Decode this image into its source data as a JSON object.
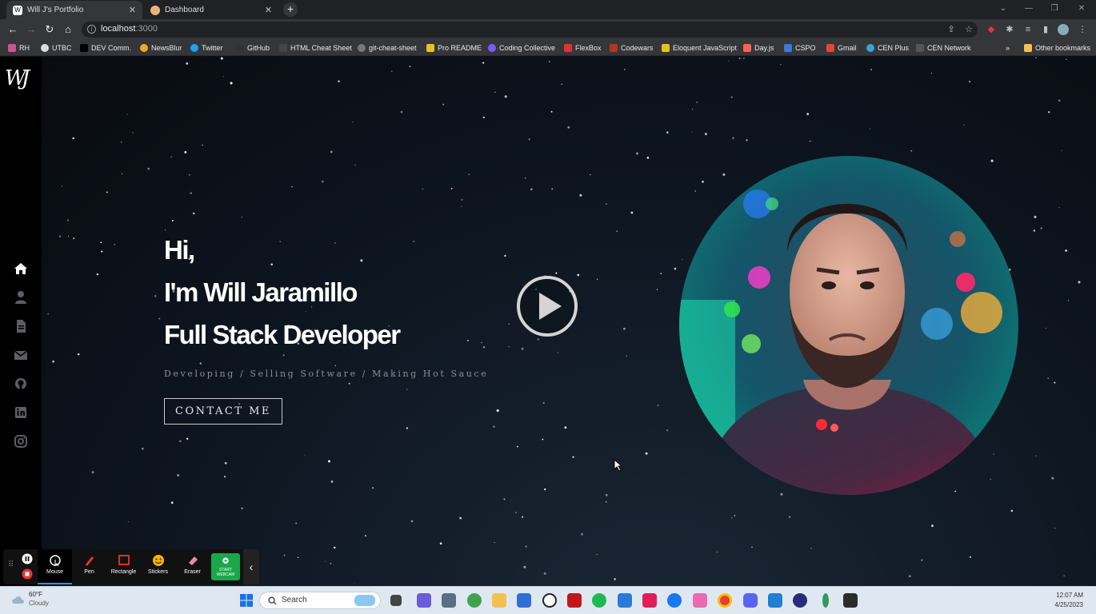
{
  "browser": {
    "tabs": [
      {
        "title": "Will J's Portfolio",
        "active": true
      },
      {
        "title": "Dashboard",
        "active": false
      }
    ],
    "url_host": "localhost",
    "url_port": ":3000",
    "bookmarks": [
      "RH",
      "UTBC",
      "DEV Comm.",
      "NewsBlur",
      "Twitter",
      "GitHub",
      "HTML Cheat Sheet",
      "git-cheat-sheet",
      "Pro README",
      "Coding Collective",
      "FlexBox",
      "Codewars",
      "Eloquent JavaScript",
      "Day.js",
      "CSPO",
      "Gmail",
      "CEN Plus",
      "CEN Network"
    ],
    "other_bookmarks": "Other bookmarks",
    "more_bookmarks": "»"
  },
  "sidebar": {
    "logo": "WJ",
    "icons": [
      "home-icon",
      "user-icon",
      "document-icon",
      "mail-icon",
      "github-icon",
      "linkedin-icon",
      "instagram-icon"
    ]
  },
  "hero": {
    "greeting": "Hi,",
    "intro_prefix": "I'm ",
    "name": "Will Jaramillo",
    "role": "Full Stack Developer",
    "tagline": "Developing / Selling Software / Making Hot Sauce",
    "cta_label": "CONTACT ME"
  },
  "recorder": {
    "tools": [
      "Mouse",
      "Pen",
      "Rectangle",
      "Stickers",
      "Eraser",
      "START WEBCAM"
    ],
    "selected": "Mouse"
  },
  "taskbar": {
    "temperature": "60°F",
    "condition": "Cloudy",
    "search_label": "Search",
    "time": "12:07 AM",
    "date": "4/25/2023"
  },
  "colors": {
    "page_bg": "#0d1117",
    "sidebar_bg": "#000000",
    "heading": "#ffffff",
    "tagline": "#8b8f95"
  }
}
